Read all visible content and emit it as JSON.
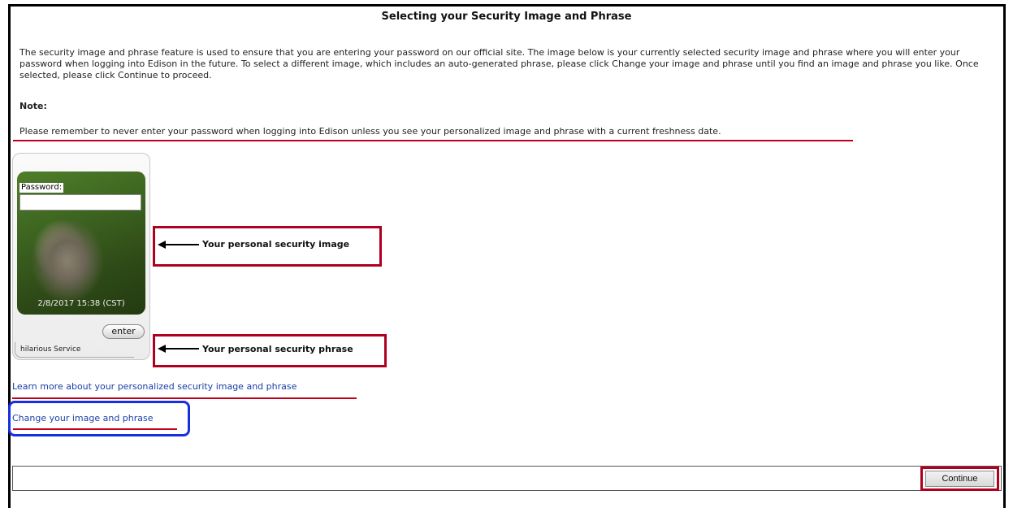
{
  "page": {
    "title": "Selecting your Security Image and Phrase",
    "intro": "The security image and phrase feature is used to ensure that you are entering your password on our official site. The image below is your currently selected security image and phrase where you will enter your password when logging into Edison in the future. To select a different image, which includes an auto-generated phrase, please click Change your image and phrase until you find an image and phrase you like. Once selected, please click Continue to proceed.",
    "note_label": "Note:",
    "reminder": "Please remember to never enter your password when logging into Edison unless you see your personalized image and phrase with a current freshness date."
  },
  "widget": {
    "password_label": "Password:",
    "password_value": "",
    "freshness_date": "2/8/2017 15:38 (CST)",
    "enter_label": "enter",
    "phrase": "hilarious Service"
  },
  "callouts": {
    "image": "Your personal security image",
    "phrase": "Your personal security phrase"
  },
  "links": {
    "learn_more": "Learn more about your personalized security image and phrase",
    "change": "Change your image and phrase"
  },
  "footer": {
    "continue_label": "Continue"
  },
  "colors": {
    "annotation_red": "#b00020",
    "annotation_blue": "#1530e0",
    "link_blue": "#1a3fa8"
  }
}
